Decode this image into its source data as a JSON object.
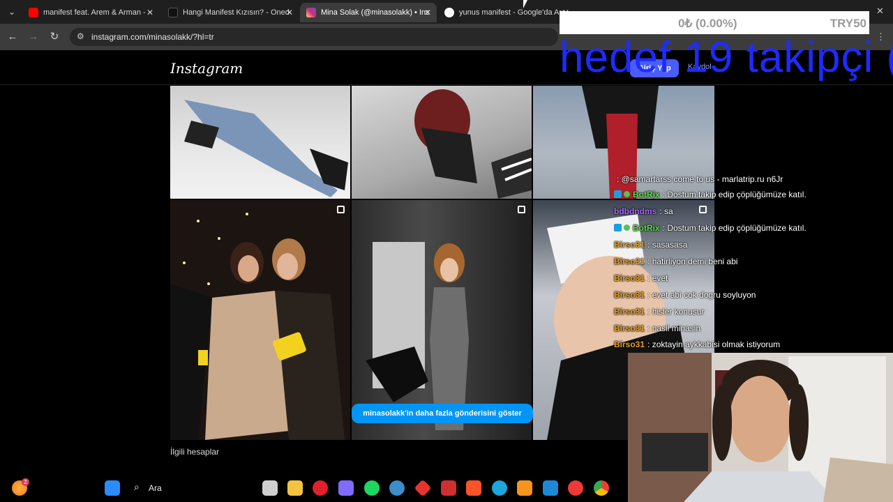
{
  "browser": {
    "tabs": [
      {
        "title": "manifest feat. Arem & Arman -",
        "favicon_color": "#ff0000",
        "active": false
      },
      {
        "title": "Hangi Manifest Kızısın? - Oned",
        "favicon_color": "#222222",
        "active": false
      },
      {
        "title": "Mina Solak (@minasolakk) • Ins",
        "favicon_color": "#d62976",
        "active": true
      },
      {
        "title": "yunus manifest - Google'da Ara",
        "favicon_color": "#4285f4",
        "active": false
      }
    ],
    "url": "instagram.com/minasolakk/?hl=tr"
  },
  "instagram": {
    "logo": "Instagram",
    "login_button": "Giriş Yap",
    "signup_link": "Kaydol",
    "more_posts_button": "minasolakk'in daha fazla gönderisini göster",
    "related_accounts": "İlgili hesaplar"
  },
  "stream_overlay": {
    "donation_amount": "0₺ (0.00%)",
    "donation_code": "TRY50",
    "goal_text": "hedef 19 takipçi (",
    "chat": [
      {
        "user": "",
        "user_color": "#e0344a",
        "message": ": @samartarss come to us - marlatrip.ru n6Jr",
        "badge": false
      },
      {
        "user": "BotRix",
        "user_color": "#5fdc4a",
        "message": ": Dostum takip edip çöplüğümüze katıl.",
        "badge": true
      },
      {
        "user": "bdbdndms",
        "user_color": "#a867ff",
        "message": ": sa",
        "badge": false
      },
      {
        "user": "BotRix",
        "user_color": "#5fdc4a",
        "message": ": Dostum takip edip çöplüğümüze katıl.",
        "badge": true
      },
      {
        "user": "Birso31",
        "user_color": "#e5a22a",
        "message": ": sasasasa",
        "badge": false
      },
      {
        "user": "Birso31",
        "user_color": "#e5a22a",
        "message": ": hatirliyon demi beni abi",
        "badge": false
      },
      {
        "user": "Birso31",
        "user_color": "#e5a22a",
        "message": ": evet",
        "badge": false
      },
      {
        "user": "Birso31",
        "user_color": "#e5a22a",
        "message": ": evet abi cok dogru soyluyon",
        "badge": false
      },
      {
        "user": "Birso31",
        "user_color": "#e5a22a",
        "message": ": hisler konusur",
        "badge": false
      },
      {
        "user": "Birso31",
        "user_color": "#e5a22a",
        "message": ": nasil minasin",
        "badge": false
      },
      {
        "user": "Birso31",
        "user_color": "#e5a22a",
        "message": ": zoktayin aykkabisi olmak istiyorum",
        "badge": false
      }
    ]
  },
  "taskbar": {
    "search_label": "Ara",
    "notification_count": "2",
    "apps": [
      {
        "name": "windows-start",
        "color": "#2b8cff"
      },
      {
        "name": "task-view",
        "color": "#cfcfcf"
      },
      {
        "name": "file-explorer",
        "color": "#f5c242"
      },
      {
        "name": "opera",
        "color": "#e0202b"
      },
      {
        "name": "copilot",
        "color": "#7f6bff"
      },
      {
        "name": "spotify",
        "color": "#1ed760"
      },
      {
        "name": "steam",
        "color": "#3b8dcc"
      },
      {
        "name": "app-red",
        "color": "#e8342f"
      },
      {
        "name": "app-rockstar",
        "color": "#cf2f2f"
      },
      {
        "name": "brave",
        "color": "#fb542b"
      },
      {
        "name": "edge",
        "color": "#1ea5d9"
      },
      {
        "name": "app-orange",
        "color": "#f7941d"
      },
      {
        "name": "vscode",
        "color": "#1e88d6"
      },
      {
        "name": "vivaldi",
        "color": "#ef3939"
      },
      {
        "name": "chrome",
        "color": "#4caf50"
      }
    ]
  }
}
